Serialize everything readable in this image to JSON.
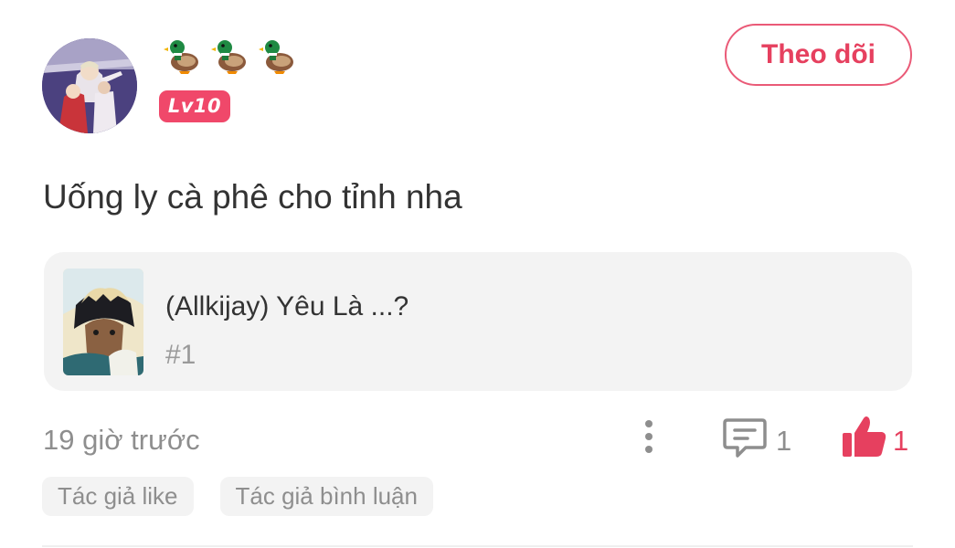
{
  "user": {
    "avatar_icon": "user-avatar",
    "ducks": [
      "duck-icon",
      "duck-icon",
      "duck-icon"
    ],
    "level": "Lv10"
  },
  "follow_label": "Theo dõi",
  "post": {
    "text": "Uống ly cà phê cho tỉnh nha"
  },
  "story": {
    "title": "(Allkijay) Yêu Là ...?",
    "chapter": "#1"
  },
  "meta": {
    "time": "19 giờ trước",
    "comment_count": "1",
    "like_count": "1"
  },
  "tags": [
    "Tác giả like",
    "Tác giả bình luận"
  ],
  "colors": {
    "accent": "#e6405f",
    "badge": "#f0486a",
    "card_bg": "#f3f3f3",
    "muted_text": "#8e8e8e"
  }
}
